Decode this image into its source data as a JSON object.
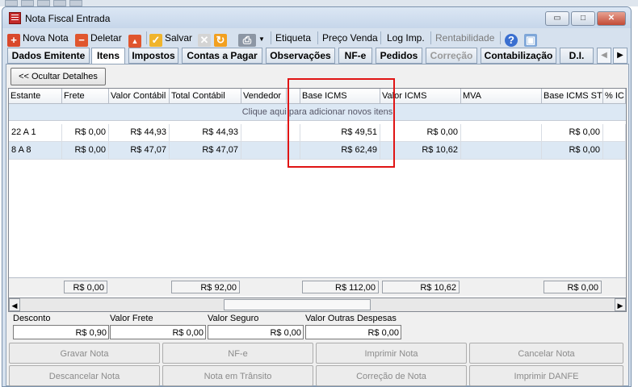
{
  "window": {
    "title": "Nota Fiscal Entrada",
    "controls": {
      "minimize": "▭",
      "maximize": "□",
      "close": "✕"
    }
  },
  "toolbar": {
    "items": [
      {
        "label": "Nova Nota",
        "icon": "plus-icon",
        "enabled": true
      },
      {
        "label": "Deletar",
        "icon": "minus-icon",
        "enabled": true
      },
      {
        "label": "Salvar",
        "icon": "checkmark-icon",
        "enabled": true
      },
      {
        "label": "Etiqueta",
        "icon": "",
        "enabled": true
      },
      {
        "label": "Preço Venda",
        "icon": "",
        "enabled": true
      },
      {
        "label": "Log Imp.",
        "icon": "",
        "enabled": true
      },
      {
        "label": "Rentabilidade",
        "icon": "",
        "enabled": false
      }
    ],
    "icons": [
      "triangle-up-icon",
      "cancel-x-icon",
      "refresh-icon",
      "printer-icon",
      "help-icon",
      "screen-icon"
    ]
  },
  "tabs": [
    {
      "label": "Dados Emitente",
      "active": false,
      "enabled": true
    },
    {
      "label": "Itens",
      "active": true,
      "enabled": true
    },
    {
      "label": "Impostos",
      "active": false,
      "enabled": true
    },
    {
      "label": "Contas a Pagar",
      "active": false,
      "enabled": true
    },
    {
      "label": "Observações",
      "active": false,
      "enabled": true
    },
    {
      "label": "NF-e",
      "active": false,
      "enabled": true
    },
    {
      "label": "Pedidos",
      "active": false,
      "enabled": true
    },
    {
      "label": "Correção",
      "active": false,
      "enabled": false
    },
    {
      "label": "Contabilização",
      "active": false,
      "enabled": true
    },
    {
      "label": "D.I.",
      "active": false,
      "enabled": true
    }
  ],
  "details_toggle": "<< Ocultar Detalhes",
  "grid": {
    "columns": [
      "Estante",
      "Frete",
      "Valor Contábil",
      "Total Contábil",
      "Vendedor",
      "",
      "Base ICMS",
      "Valor ICMS",
      "MVA",
      "Base ICMS ST",
      "% IC"
    ],
    "new_row_hint": "Clique aqui para adicionar novos itens",
    "rows": [
      [
        "22 A 1",
        "R$ 0,00",
        "R$ 44,93",
        "R$ 44,93",
        "",
        "",
        "R$ 49,51",
        "R$ 0,00",
        "",
        "R$ 0,00",
        ""
      ],
      [
        "8 A 8",
        "R$ 0,00",
        "R$ 47,07",
        "R$ 47,07",
        "",
        "",
        "R$ 62,49",
        "R$ 10,62",
        "",
        "R$ 0,00",
        ""
      ]
    ],
    "totals": {
      "frete": "R$ 0,00",
      "total_contabil": "R$ 92,00",
      "base_icms": "R$ 112,00",
      "valor_icms": "R$ 10,62",
      "base_icms_st": "R$ 0,00"
    }
  },
  "summary_fields": [
    {
      "label": "Desconto",
      "value": "R$ 0,90"
    },
    {
      "label": "Valor Frete",
      "value": "R$ 0,00"
    },
    {
      "label": "Valor Seguro",
      "value": "R$ 0,00"
    },
    {
      "label": "Valor Outras Despesas",
      "value": "R$ 0,00"
    }
  ],
  "action_buttons": [
    "Gravar Nota",
    "NF-e",
    "Imprimir Nota",
    "Cancelar Nota",
    "Descancelar Nota",
    "Nota em Trânsito",
    "Correção de Nota",
    "Imprimir DANFE"
  ],
  "colors": {
    "highlight": "#e01414",
    "selected_row": "#dce8f4",
    "window_bg": "#d6e1ee"
  }
}
